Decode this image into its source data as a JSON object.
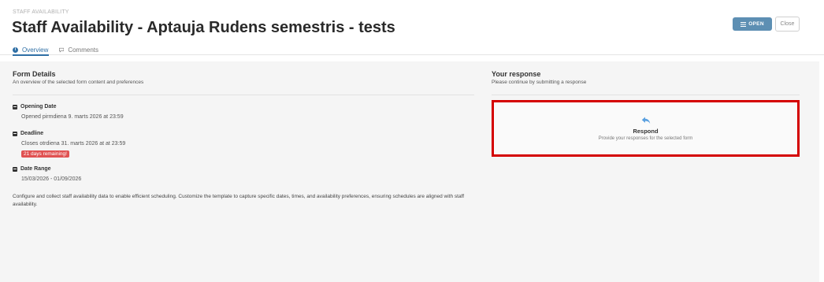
{
  "header": {
    "breadcrumb": "STAFF AVAILABILITY",
    "title": "Staff Availability - Aptauja Rudens semestris - tests",
    "open_button": "OPEN",
    "close_button": "Close"
  },
  "tabs": [
    {
      "label": "Overview",
      "icon": "info-icon",
      "active": true
    },
    {
      "label": "Comments",
      "icon": "comment-icon",
      "active": false
    }
  ],
  "form_details": {
    "title": "Form Details",
    "subtitle": "An overview of the selected form content and preferences",
    "opening_date": {
      "label": "Opening Date",
      "value": "Opened pirmdiena 9. marts 2026 at 23:59",
      "icon": "calendar-icon"
    },
    "deadline": {
      "label": "Deadline",
      "value": "Closes otrdiena 31. marts 2026 at at 23:59",
      "badge": "21 days remaining!",
      "icon": "calendar-icon"
    },
    "date_range": {
      "label": "Date Range",
      "value": "15/03/2026 - 01/09/2026",
      "icon": "calendar-range-icon"
    },
    "description": "Configure and collect staff availability data to enable efficient scheduling. Customize the template to capture specific dates, times, and availability preferences, ensuring schedules are aligned with staff availability."
  },
  "response": {
    "title": "Your response",
    "subtitle": "Please continue by submitting a response",
    "respond_title": "Respond",
    "respond_subtitle": "Provide your responses for the selected form",
    "respond_icon": "reply-icon"
  },
  "colors": {
    "accent": "#2f6fa5",
    "open_button": "#5d8fb3",
    "badge": "#e05252",
    "highlight_border": "#d40000"
  }
}
